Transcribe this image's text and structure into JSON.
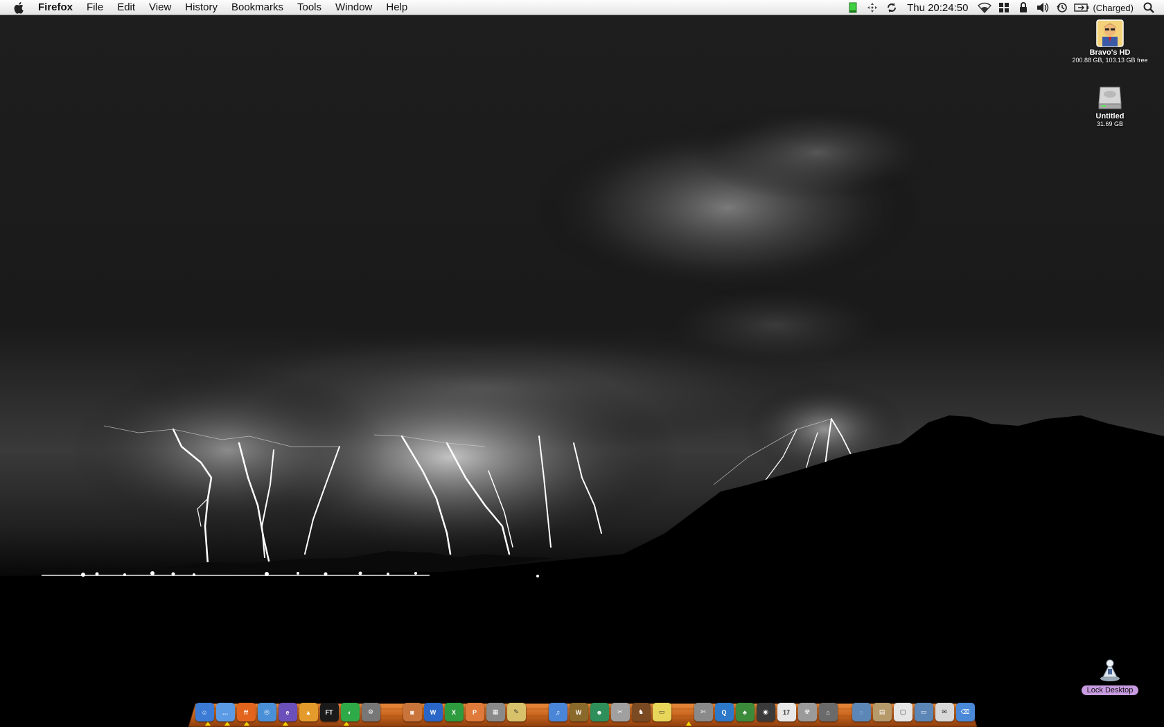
{
  "menubar": {
    "apple_icon": "apple-logo-icon",
    "app_name": "Firefox",
    "menus": [
      "File",
      "Edit",
      "View",
      "History",
      "Bookmarks",
      "Tools",
      "Window",
      "Help"
    ],
    "clock": "Thu 20:24:50",
    "battery_status": "(Charged)",
    "status_icons": [
      "green-battery-meter-icon",
      "spaces-arrows-icon",
      "sync-icon",
      "clock-text",
      "wifi-icon",
      "spaces-grid-icon",
      "lock-icon",
      "volume-icon",
      "time-machine-icon",
      "battery-icon",
      "spotlight-icon"
    ]
  },
  "desktop": {
    "icons": [
      {
        "label": "Bravo's HD",
        "sub": "200.88 GB, 103.13 GB free",
        "icon": "hard-drive-avatar-icon"
      },
      {
        "label": "Untitled",
        "sub": "31.69 GB",
        "icon": "external-drive-icon"
      },
      {
        "label": "Lock Desktop",
        "icon": "lock-desktop-icon"
      }
    ]
  },
  "dock": {
    "items": [
      {
        "name": "finder",
        "color": "#3b7bd6",
        "glyph": "☺"
      },
      {
        "name": "ichat",
        "color": "#5b9be6",
        "glyph": "…"
      },
      {
        "name": "firefox",
        "color": "#e3651d",
        "glyph": "ff"
      },
      {
        "name": "safari",
        "color": "#4a90d9",
        "glyph": "◎"
      },
      {
        "name": "entourage",
        "color": "#6b4fbb",
        "glyph": "e"
      },
      {
        "name": "vlc",
        "color": "#e49b2b",
        "glyph": "▲"
      },
      {
        "name": "full-tilt",
        "color": "#1a1a1a",
        "glyph": "FT"
      },
      {
        "name": "color-sync",
        "color": "#2faa48",
        "glyph": "◐"
      },
      {
        "name": "system-prefs",
        "color": "#777777",
        "glyph": "⚙"
      },
      {
        "name": "gap"
      },
      {
        "name": "preview",
        "color": "#c9743b",
        "glyph": "◙"
      },
      {
        "name": "word",
        "color": "#2a66c8",
        "glyph": "W"
      },
      {
        "name": "excel",
        "color": "#2e9c3e",
        "glyph": "X"
      },
      {
        "name": "powerpoint",
        "color": "#e07a3b",
        "glyph": "P"
      },
      {
        "name": "calculator",
        "color": "#8a8a8a",
        "glyph": "▦"
      },
      {
        "name": "textedit",
        "color": "#d7c16a",
        "glyph": "✎"
      },
      {
        "name": "gap"
      },
      {
        "name": "itunes",
        "color": "#4a86d8",
        "glyph": "♫"
      },
      {
        "name": "warcraft",
        "color": "#8a6a2a",
        "glyph": "W"
      },
      {
        "name": "messenger",
        "color": "#2e8f5a",
        "glyph": "☻"
      },
      {
        "name": "image-capture",
        "color": "#a0a0a0",
        "glyph": "✂"
      },
      {
        "name": "horse",
        "color": "#7a4a22",
        "glyph": "♞"
      },
      {
        "name": "stickies",
        "color": "#e8d65a",
        "glyph": "▭"
      },
      {
        "name": "gap"
      },
      {
        "name": "scissors",
        "color": "#8a8a8a",
        "glyph": "✄"
      },
      {
        "name": "quicktime",
        "color": "#2d78c8",
        "glyph": "Q"
      },
      {
        "name": "island-game",
        "color": "#3b8b3b",
        "glyph": "♣"
      },
      {
        "name": "timemachine",
        "color": "#3a3a3a",
        "glyph": "◉"
      },
      {
        "name": "ical",
        "color": "#e8e8e8",
        "glyph": "17"
      },
      {
        "name": "disk-utility",
        "color": "#9a9a9a",
        "glyph": "☢"
      },
      {
        "name": "utilities",
        "color": "#6a6a6a",
        "glyph": "⌂"
      },
      {
        "name": "sep"
      },
      {
        "name": "network-folder",
        "color": "#5c86b6",
        "glyph": "◌"
      },
      {
        "name": "documents-stack",
        "color": "#b79a6a",
        "glyph": "▤"
      },
      {
        "name": "document",
        "color": "#e6e6e6",
        "glyph": "▢"
      },
      {
        "name": "downloads-folder",
        "color": "#5c86b6",
        "glyph": "▭"
      },
      {
        "name": "mail-stack",
        "color": "#d8d8d8",
        "glyph": "✉"
      },
      {
        "name": "trash",
        "color": "#4a88d8",
        "glyph": "⌫"
      }
    ]
  },
  "colors": {
    "menubar_bg": "#ededed",
    "dock_wood": "#c8641e",
    "lock_label_bg": "#c89be0"
  }
}
